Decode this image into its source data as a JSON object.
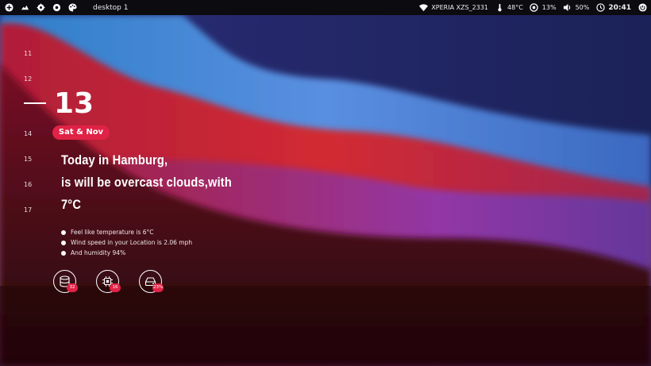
{
  "topbar": {
    "desktop_label": "desktop 1",
    "device_name": "XPERIA XZS_2331",
    "temperature": "48°C",
    "cpu": "13%",
    "volume": "50%",
    "time": "20:41"
  },
  "calendar": {
    "days": [
      "11",
      "12",
      "14",
      "15",
      "16",
      "17"
    ],
    "current_day": "13",
    "date_badge": "Sat & Nov"
  },
  "weather": {
    "line1": "Today in Hamburg,",
    "line2": "is will be overcast clouds,with",
    "line3": "7°C",
    "details": [
      "Feel like temperature is 6°C",
      "Wind speed in your Location is 2.06 mph",
      "And humidity 94%"
    ]
  },
  "widgets": [
    {
      "icon": "database-icon",
      "value": "32"
    },
    {
      "icon": "cpu-icon",
      "value": "16"
    },
    {
      "icon": "harddisk-icon",
      "value": "23%"
    }
  ],
  "colors": {
    "accent": "#e02246",
    "topbar": "#0b0b10",
    "navy": "#1e2560",
    "blue_wave": "#4a86d8",
    "red_wave": "#c0243a"
  }
}
